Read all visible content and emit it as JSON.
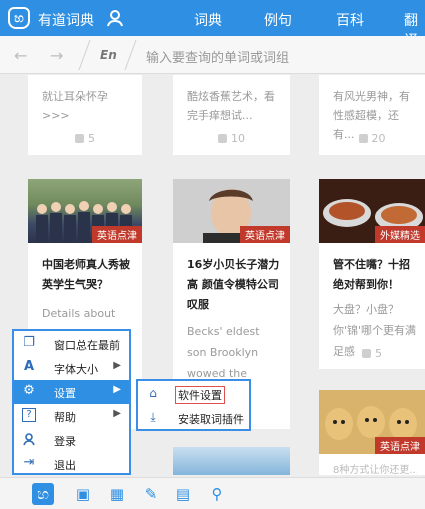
{
  "header": {
    "brand": "有道词典",
    "tabs": [
      "词典",
      "例句",
      "百科",
      "翻译"
    ],
    "active_tab": "词典",
    "accent": "#2e8fe3"
  },
  "search": {
    "lang": "En",
    "placeholder": "输入要查询的单词或词组"
  },
  "top_cards": [
    {
      "snippet": "就让耳朵怀孕\n>>>",
      "likes": "5"
    },
    {
      "snippet": "酷炫香蕉艺术，看完手痒想试...",
      "likes": "10"
    },
    {
      "snippet": "有风光男神，有性感超模，还有...",
      "likes": "20"
    }
  ],
  "cards": [
    {
      "tag": "英语点津",
      "title": "中国老师真人秀被英学生气哭？",
      "desc": "Details about BBC"
    },
    {
      "tag": "英语点津",
      "title": "16岁小贝长子潜力高 颜值令模特公司叹服",
      "desc": "Becks' eldest son Brooklyn wowed the"
    },
    {
      "tag": "外媒精选",
      "title": "管不住嘴？十招绝对帮到你！",
      "desc": "大盘？小盘？你'锦'哪个更有满足感",
      "likes": "5"
    }
  ],
  "bottom_card": {
    "tag": "英语点津",
    "title": "8种方式让你还更..."
  },
  "menu": {
    "items": [
      {
        "label": "窗口总在最前",
        "icon": "window-icon"
      },
      {
        "label": "字体大小",
        "icon": "font-size-icon",
        "sub": "▶"
      },
      {
        "label": "设置",
        "icon": "gear-icon",
        "sub": "▶"
      },
      {
        "label": "帮助",
        "icon": "help-icon",
        "sub": "▶"
      },
      {
        "label": "登录",
        "icon": "user-icon"
      },
      {
        "label": "退出",
        "icon": "exit-icon"
      }
    ]
  },
  "submenu": {
    "items": [
      {
        "label": "软件设置",
        "icon": "settings-app-icon"
      },
      {
        "label": "安装取词插件",
        "icon": "download-icon"
      }
    ]
  }
}
